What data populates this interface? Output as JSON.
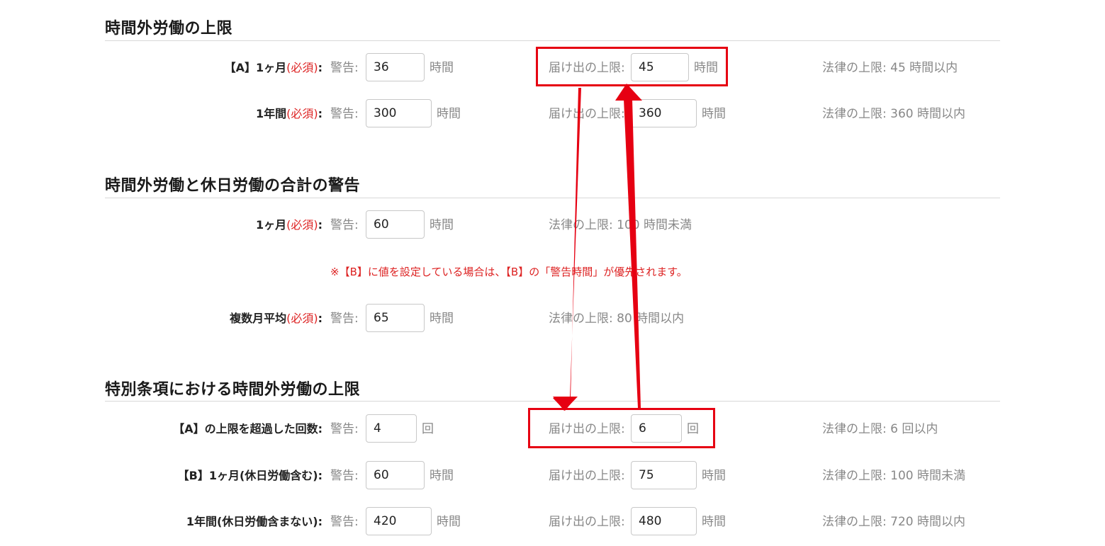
{
  "sections": [
    {
      "title": "時間外労働の上限",
      "rows": [
        {
          "label_main": "【A】1ヶ月",
          "label_req": "(必須)",
          "label_colon": ":",
          "warn_label": "警告:",
          "warn_value": "36",
          "warn_unit": "時間",
          "filing_label": "届け出の上限:",
          "filing_value": "45",
          "filing_unit": "時間",
          "legal": "法律の上限: 45 時間以内"
        },
        {
          "label_main": "1年間",
          "label_req": "(必須)",
          "label_colon": ":",
          "warn_label": "警告:",
          "warn_value": "300",
          "warn_unit": "時間",
          "filing_label": "届け出の上限:",
          "filing_value": "360",
          "filing_unit": "時間",
          "legal": "法律の上限: 360 時間以内"
        }
      ]
    },
    {
      "title": "時間外労働と休日労働の合計の警告",
      "rows": [
        {
          "label_main": "1ヶ月",
          "label_req": "(必須)",
          "label_colon": ":",
          "warn_label": "警告:",
          "warn_value": "60",
          "warn_unit": "時間",
          "legal": "法律の上限: 100 時間未満"
        },
        {
          "label_main": "複数月平均",
          "label_req": "(必須)",
          "label_colon": ":",
          "warn_label": "警告:",
          "warn_value": "65",
          "warn_unit": "時間",
          "legal": "法律の上限: 80 時間以内"
        }
      ],
      "note": "※【B】に値を設定している場合は、【B】の「警告時間」が優先されます。"
    },
    {
      "title": "特別条項における時間外労働の上限",
      "rows": [
        {
          "label_main": "【A】の上限を超過した回数",
          "label_colon": ":",
          "warn_label": "警告:",
          "warn_value": "4",
          "warn_unit": "回",
          "filing_label": "届け出の上限:",
          "filing_value": "6",
          "filing_unit": "回",
          "legal": "法律の上限: 6 回以内"
        },
        {
          "label_main": "【B】1ヶ月(休日労働含む)",
          "label_colon": ":",
          "warn_label": "警告:",
          "warn_value": "60",
          "warn_unit": "時間",
          "filing_label": "届け出の上限:",
          "filing_value": "75",
          "filing_unit": "時間",
          "legal": "法律の上限: 100 時間未満"
        },
        {
          "label_main": "1年間(休日労働含まない)",
          "label_colon": ":",
          "warn_label": "警告:",
          "warn_value": "420",
          "warn_unit": "時間",
          "filing_label": "届け出の上限:",
          "filing_value": "480",
          "filing_unit": "時間",
          "legal": "法律の上限: 720 時間以内"
        }
      ]
    }
  ],
  "annotation": {
    "color": "#e60012"
  }
}
